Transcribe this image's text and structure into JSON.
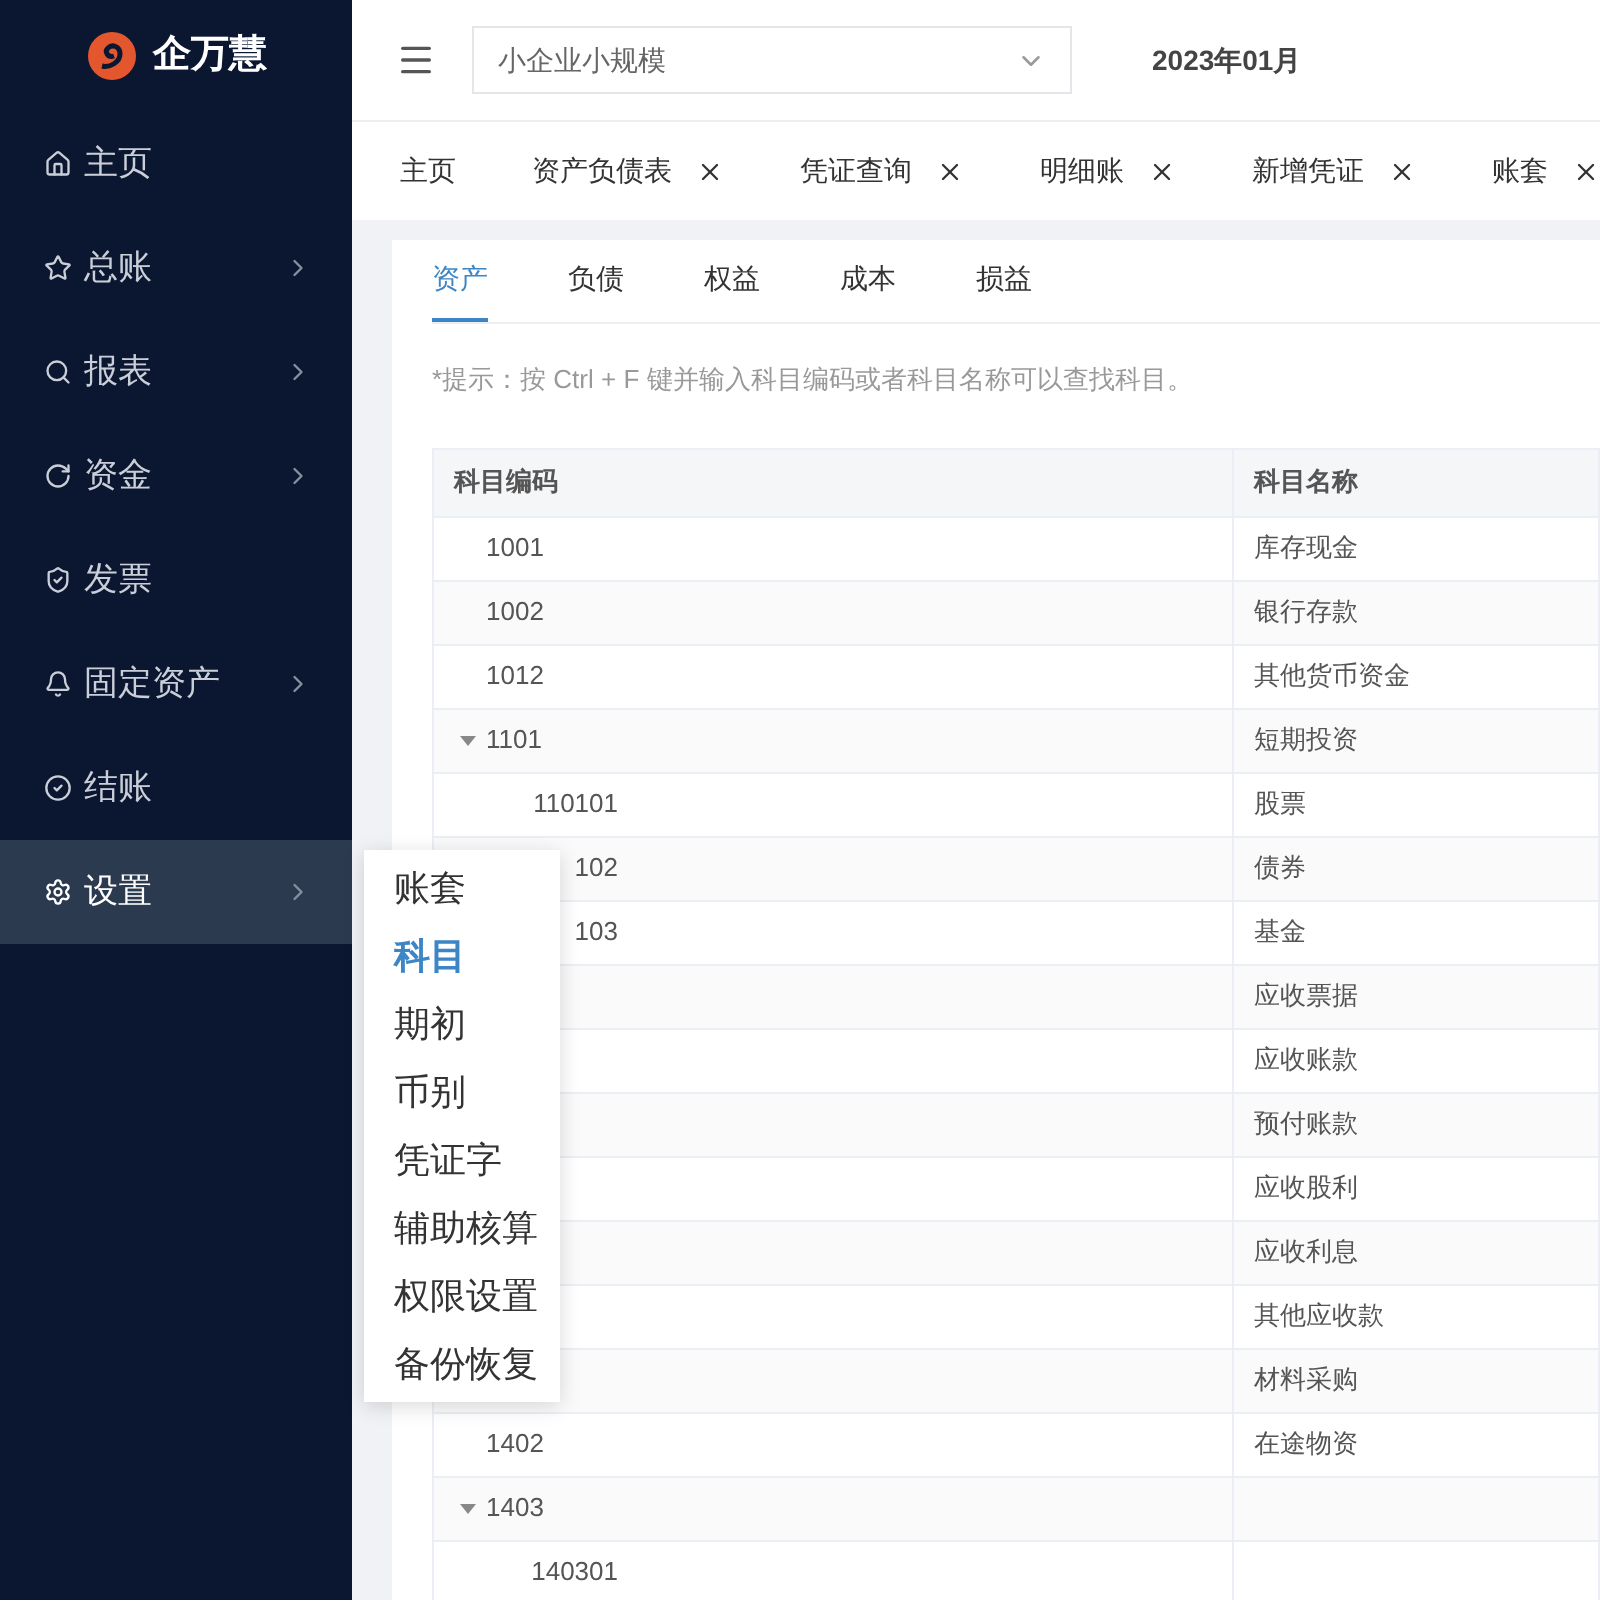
{
  "brand": {
    "name": "企万慧"
  },
  "sidebar": {
    "items": [
      {
        "label": "主页",
        "has_submenu": false,
        "selected": false
      },
      {
        "label": "总账",
        "has_submenu": true,
        "selected": false
      },
      {
        "label": "报表",
        "has_submenu": true,
        "selected": false
      },
      {
        "label": "资金",
        "has_submenu": true,
        "selected": false
      },
      {
        "label": "发票",
        "has_submenu": false,
        "selected": false
      },
      {
        "label": "固定资产",
        "has_submenu": true,
        "selected": false
      },
      {
        "label": "结账",
        "has_submenu": false,
        "selected": false
      },
      {
        "label": "设置",
        "has_submenu": true,
        "selected": true
      }
    ]
  },
  "submenu": {
    "items": [
      {
        "label": "账套",
        "selected": false
      },
      {
        "label": "科目",
        "selected": true
      },
      {
        "label": "期初",
        "selected": false
      },
      {
        "label": "币别",
        "selected": false
      },
      {
        "label": "凭证字",
        "selected": false
      },
      {
        "label": "辅助核算",
        "selected": false
      },
      {
        "label": "权限设置",
        "selected": false
      },
      {
        "label": "备份恢复",
        "selected": false
      }
    ]
  },
  "toolbar": {
    "company_select": {
      "value": "小企业小规模"
    },
    "period": "2023年01月"
  },
  "page_tabs": [
    {
      "label": "主页",
      "closable": false
    },
    {
      "label": "资产负债表",
      "closable": true
    },
    {
      "label": "凭证查询",
      "closable": true
    },
    {
      "label": "明细账",
      "closable": true
    },
    {
      "label": "新增凭证",
      "closable": true
    },
    {
      "label": "账套",
      "closable": true
    }
  ],
  "category_tabs": [
    {
      "label": "资产",
      "selected": true
    },
    {
      "label": "负债",
      "selected": false
    },
    {
      "label": "权益",
      "selected": false
    },
    {
      "label": "成本",
      "selected": false
    },
    {
      "label": "损益",
      "selected": false
    }
  ],
  "hint": "*提示：按 Ctrl + F 键并输入科目编码或者科目名称可以查找科目。",
  "table": {
    "columns": [
      "科目编码",
      "科目名称"
    ],
    "rows": [
      {
        "code": "1001",
        "name": "库存现金"
      },
      {
        "code": "1002",
        "name": "银行存款"
      },
      {
        "code": "1012",
        "name": "其他货币资金"
      },
      {
        "code": "1101",
        "name": "短期投资",
        "expanded": true,
        "children": [
          {
            "code": "110101",
            "name": "股票"
          },
          {
            "code": "102",
            "name": "债券"
          },
          {
            "code": "103",
            "name": "基金"
          }
        ]
      },
      {
        "name": "应收票据"
      },
      {
        "name": "应收账款"
      },
      {
        "name": "预付账款"
      },
      {
        "name": "应收股利"
      },
      {
        "name": "应收利息"
      },
      {
        "name": "其他应收款"
      },
      {
        "name": "材料采购"
      },
      {
        "code": "1402",
        "name": "在途物资"
      },
      {
        "code": "1403",
        "expanded": true,
        "children": [
          {
            "code": "140301"
          }
        ]
      }
    ]
  }
}
